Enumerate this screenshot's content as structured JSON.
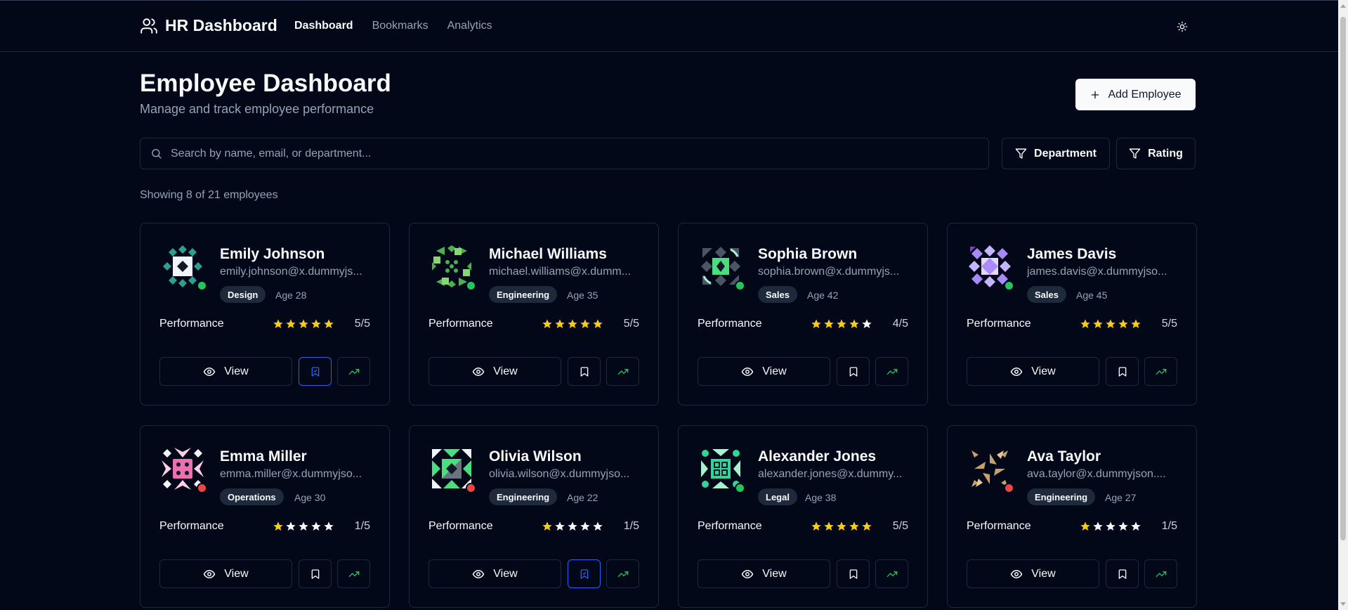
{
  "header": {
    "brand": "HR Dashboard",
    "nav": [
      "Dashboard",
      "Bookmarks",
      "Analytics"
    ],
    "active_nav": "Dashboard"
  },
  "page": {
    "title": "Employee Dashboard",
    "subtitle": "Manage and track employee performance",
    "add_button": "Add Employee"
  },
  "search": {
    "placeholder": "Search by name, email, or department...",
    "value": ""
  },
  "filters": {
    "department": "Department",
    "rating": "Rating"
  },
  "showing": "Showing 8 of 21 employees",
  "labels": {
    "performance": "Performance",
    "view": "View"
  },
  "colors": {
    "star_filled": "#facc15",
    "star_empty": "#f8fafc",
    "online": "#22c55e",
    "offline": "#ef4444",
    "trend": "#22c55e",
    "bookmark_active": "#2563eb"
  },
  "employees": [
    {
      "name": "Emily Johnson",
      "email": "emily.johnson@x.dummyjs...",
      "department": "Design",
      "age": "Age 28",
      "rating": 5,
      "rating_text": "5/5",
      "online": true,
      "bookmarked": true,
      "avatar": "teal-diamond"
    },
    {
      "name": "Michael Williams",
      "email": "michael.williams@x.dumm...",
      "department": "Engineering",
      "age": "Age 35",
      "rating": 5,
      "rating_text": "5/5",
      "online": true,
      "bookmarked": false,
      "avatar": "green-dots"
    },
    {
      "name": "Sophia Brown",
      "email": "sophia.brown@x.dummyjs...",
      "department": "Sales",
      "age": "Age 42",
      "rating": 4,
      "rating_text": "4/5",
      "online": true,
      "bookmarked": false,
      "avatar": "green-gray"
    },
    {
      "name": "James Davis",
      "email": "james.davis@x.dummyjso...",
      "department": "Sales",
      "age": "Age 45",
      "rating": 5,
      "rating_text": "5/5",
      "online": true,
      "bookmarked": false,
      "avatar": "purple-check"
    },
    {
      "name": "Emma Miller",
      "email": "emma.miller@x.dummyjso...",
      "department": "Operations",
      "age": "Age 30",
      "rating": 1,
      "rating_text": "1/5",
      "online": false,
      "bookmarked": false,
      "avatar": "pink-dice"
    },
    {
      "name": "Olivia Wilson",
      "email": "olivia.wilson@x.dummyjso...",
      "department": "Engineering",
      "age": "Age 22",
      "rating": 1,
      "rating_text": "1/5",
      "online": false,
      "bookmarked": true,
      "avatar": "green-triangles"
    },
    {
      "name": "Alexander Jones",
      "email": "alexander.jones@x.dummy...",
      "department": "Legal",
      "age": "Age 38",
      "rating": 5,
      "rating_text": "5/5",
      "online": true,
      "bookmarked": false,
      "avatar": "mint-grid"
    },
    {
      "name": "Ava Taylor",
      "email": "ava.taylor@x.dummyjson....",
      "department": "Engineering",
      "age": "Age 27",
      "rating": 1,
      "rating_text": "1/5",
      "online": false,
      "bookmarked": false,
      "avatar": "tan-pinwheel"
    }
  ]
}
